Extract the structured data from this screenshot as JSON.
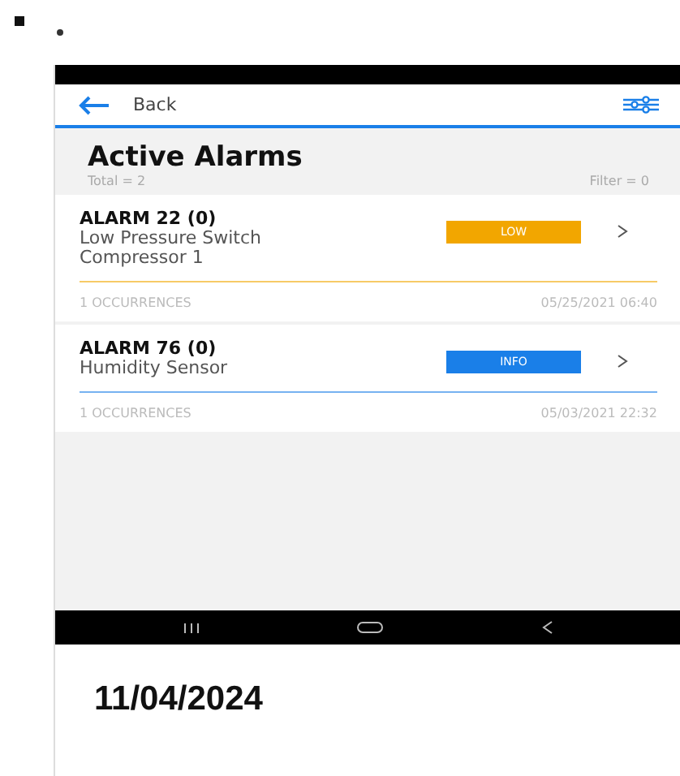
{
  "topbar": {
    "back_label": "Back"
  },
  "header": {
    "title": "Active Alarms",
    "total": "Total = 2",
    "filter": "Filter = 0"
  },
  "alarms": [
    {
      "title": "ALARM 22 (0)",
      "description": "Low Pressure Switch Compressor 1",
      "severity": "LOW",
      "color": "#f2a600",
      "occurrences": "1 OCCURRENCES",
      "timestamp": "05/25/2021 06:40"
    },
    {
      "title": "ALARM 76 (0)",
      "description": "Humidity Sensor",
      "severity": "INFO",
      "color": "#1a7fe8",
      "occurrences": "1 OCCURRENCES",
      "timestamp": "05/03/2021 22:32"
    }
  ],
  "caption": {
    "date": "11/04/2024"
  }
}
